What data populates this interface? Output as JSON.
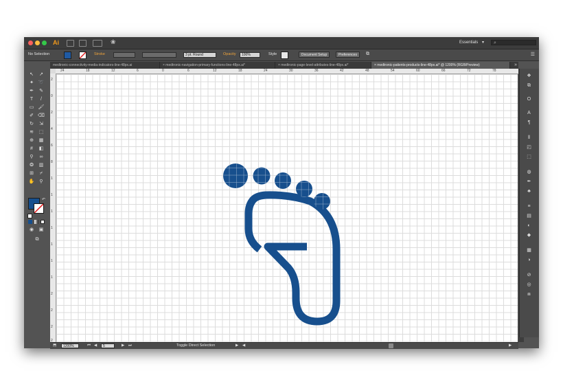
{
  "app": {
    "logo": "Ai",
    "workspace": "Essentials",
    "workspace_caret": "▾",
    "search_placeholder": ""
  },
  "control_bar": {
    "selection": "No Selection",
    "stroke_label": "Stroke",
    "brush_value": "3 pt. Round",
    "opacity_label": "Opacity",
    "opacity_value": "100%",
    "style_label": "Style",
    "document_setup": "Document Setup",
    "preferences": "Preferences",
    "fill_color": "#1f5aa3"
  },
  "tabs": [
    {
      "label": "medtronic-connectivity-media-indicators-line-48px.ai"
    },
    {
      "label": "× medtronic-navigation-primary-functions-line-48px.ai*"
    },
    {
      "label": "× medtronic-page-level-attributes-line-48px.ai*"
    },
    {
      "label": "× medtronic-patients-products-line-48px.ai* @ 1200% (RGB/Preview)"
    }
  ],
  "tab_overflow": "»",
  "ruler_h": [
    "24",
    "18",
    "12",
    "6",
    "0",
    "6",
    "12",
    "18",
    "24",
    "30",
    "36",
    "42",
    "48",
    "54",
    "60",
    "66",
    "72",
    "78"
  ],
  "ruler_v": [
    "2",
    "0",
    "2",
    "4",
    "6",
    "8",
    "1",
    "1",
    "1",
    "1",
    "1",
    "1",
    "1",
    "2",
    "2",
    "2",
    "2"
  ],
  "artwork": {
    "icon": "foot-icon",
    "color": "#174f8d"
  },
  "status_bar": {
    "zoom": "1200%",
    "page": "5",
    "tool_hint": "Toggle Direct Selection"
  },
  "colors": {
    "accent": "#f29a1b",
    "fill": "#174f8d"
  }
}
